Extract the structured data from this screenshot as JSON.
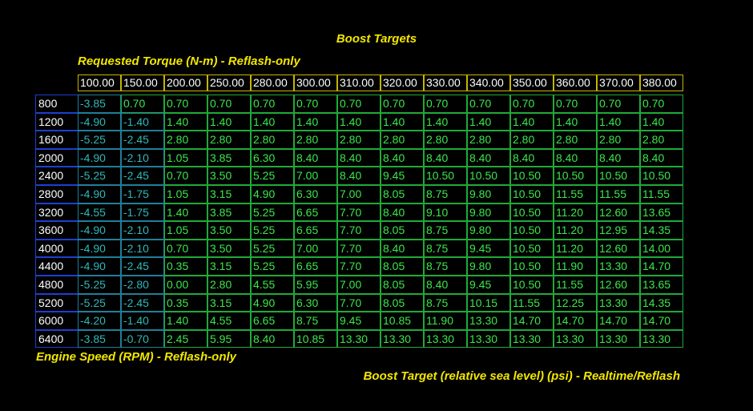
{
  "title": "Boost Targets",
  "x_axis_label": "Requested Torque (N-m) - Reflash-only",
  "y_axis_label": "Engine Speed (RPM) - Reflash-only",
  "z_axis_label": "Boost Target (relative sea level) (psi) - Realtime/Reflash",
  "columns": [
    "100.00",
    "150.00",
    "200.00",
    "250.00",
    "280.00",
    "300.00",
    "310.00",
    "320.00",
    "330.00",
    "340.00",
    "350.00",
    "360.00",
    "370.00",
    "380.00"
  ],
  "rows": [
    "800",
    "1200",
    "1600",
    "2000",
    "2400",
    "2800",
    "3200",
    "3600",
    "4000",
    "4400",
    "4800",
    "5200",
    "6000",
    "6400"
  ],
  "values": [
    [
      "-3.85",
      "0.70",
      "0.70",
      "0.70",
      "0.70",
      "0.70",
      "0.70",
      "0.70",
      "0.70",
      "0.70",
      "0.70",
      "0.70",
      "0.70",
      "0.70"
    ],
    [
      "-4.90",
      "-1.40",
      "1.40",
      "1.40",
      "1.40",
      "1.40",
      "1.40",
      "1.40",
      "1.40",
      "1.40",
      "1.40",
      "1.40",
      "1.40",
      "1.40"
    ],
    [
      "-5.25",
      "-2.45",
      "2.80",
      "2.80",
      "2.80",
      "2.80",
      "2.80",
      "2.80",
      "2.80",
      "2.80",
      "2.80",
      "2.80",
      "2.80",
      "2.80"
    ],
    [
      "-4.90",
      "-2.10",
      "1.05",
      "3.85",
      "6.30",
      "8.40",
      "8.40",
      "8.40",
      "8.40",
      "8.40",
      "8.40",
      "8.40",
      "8.40",
      "8.40"
    ],
    [
      "-5.25",
      "-2.45",
      "0.70",
      "3.50",
      "5.25",
      "7.00",
      "8.40",
      "9.45",
      "10.50",
      "10.50",
      "10.50",
      "10.50",
      "10.50",
      "10.50"
    ],
    [
      "-4.90",
      "-1.75",
      "1.05",
      "3.15",
      "4.90",
      "6.30",
      "7.00",
      "8.05",
      "8.75",
      "9.80",
      "10.50",
      "11.55",
      "11.55",
      "11.55"
    ],
    [
      "-4.55",
      "-1.75",
      "1.40",
      "3.85",
      "5.25",
      "6.65",
      "7.70",
      "8.40",
      "9.10",
      "9.80",
      "10.50",
      "11.20",
      "12.60",
      "13.65"
    ],
    [
      "-4.90",
      "-2.10",
      "1.05",
      "3.50",
      "5.25",
      "6.65",
      "7.70",
      "8.05",
      "8.75",
      "9.80",
      "10.50",
      "11.20",
      "12.95",
      "14.35"
    ],
    [
      "-4.90",
      "-2.10",
      "0.70",
      "3.50",
      "5.25",
      "7.00",
      "7.70",
      "8.40",
      "8.75",
      "9.45",
      "10.50",
      "11.20",
      "12.60",
      "14.00"
    ],
    [
      "-4.90",
      "-2.45",
      "0.35",
      "3.15",
      "5.25",
      "6.65",
      "7.70",
      "8.05",
      "8.75",
      "9.80",
      "10.50",
      "11.90",
      "13.30",
      "14.70"
    ],
    [
      "-5.25",
      "-2.80",
      "0.00",
      "2.80",
      "4.55",
      "5.95",
      "7.00",
      "8.05",
      "8.40",
      "9.45",
      "10.50",
      "11.55",
      "12.60",
      "13.65"
    ],
    [
      "-5.25",
      "-2.45",
      "0.35",
      "3.15",
      "4.90",
      "6.30",
      "7.70",
      "8.05",
      "8.75",
      "10.15",
      "11.55",
      "12.25",
      "13.30",
      "14.35"
    ],
    [
      "-4.20",
      "-1.40",
      "1.40",
      "4.55",
      "6.65",
      "8.75",
      "9.45",
      "10.85",
      "11.90",
      "13.30",
      "14.70",
      "14.70",
      "14.70",
      "14.70"
    ],
    [
      "-3.85",
      "-0.70",
      "2.45",
      "5.95",
      "8.40",
      "10.85",
      "13.30",
      "13.30",
      "13.30",
      "13.30",
      "13.30",
      "13.30",
      "13.30",
      "13.30"
    ]
  ],
  "colors": {
    "label_yellow": "#f2e600",
    "cell_green": "#39e84a",
    "cell_teal": "#2fb8b8",
    "header_border": "#c8b400",
    "row_border": "#1e3fd0"
  }
}
